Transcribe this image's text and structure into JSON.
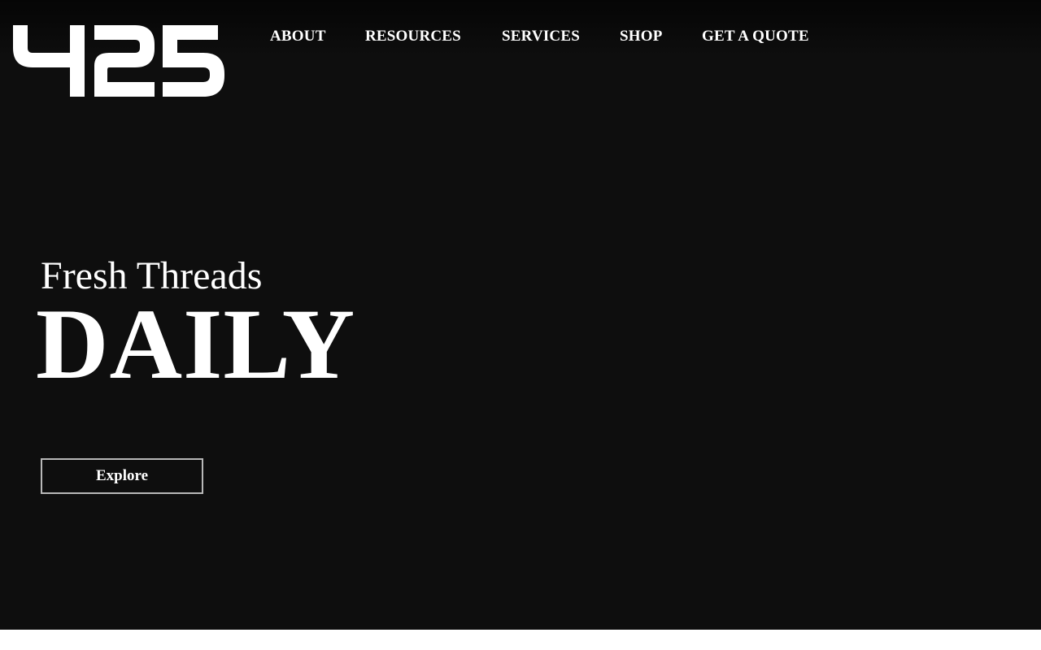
{
  "brand": {
    "logo_text": "425"
  },
  "nav": {
    "items": [
      {
        "label": "ABOUT"
      },
      {
        "label": "RESOURCES"
      },
      {
        "label": "SERVICES"
      },
      {
        "label": "SHOP"
      },
      {
        "label": "GET A QUOTE"
      }
    ]
  },
  "hero": {
    "tagline": "Fresh Threads",
    "headline": "DAILY",
    "cta_label": "Explore"
  },
  "colors": {
    "background": "#0e0e0e",
    "text": "#ffffff",
    "button_border": "#b8b8b8"
  }
}
